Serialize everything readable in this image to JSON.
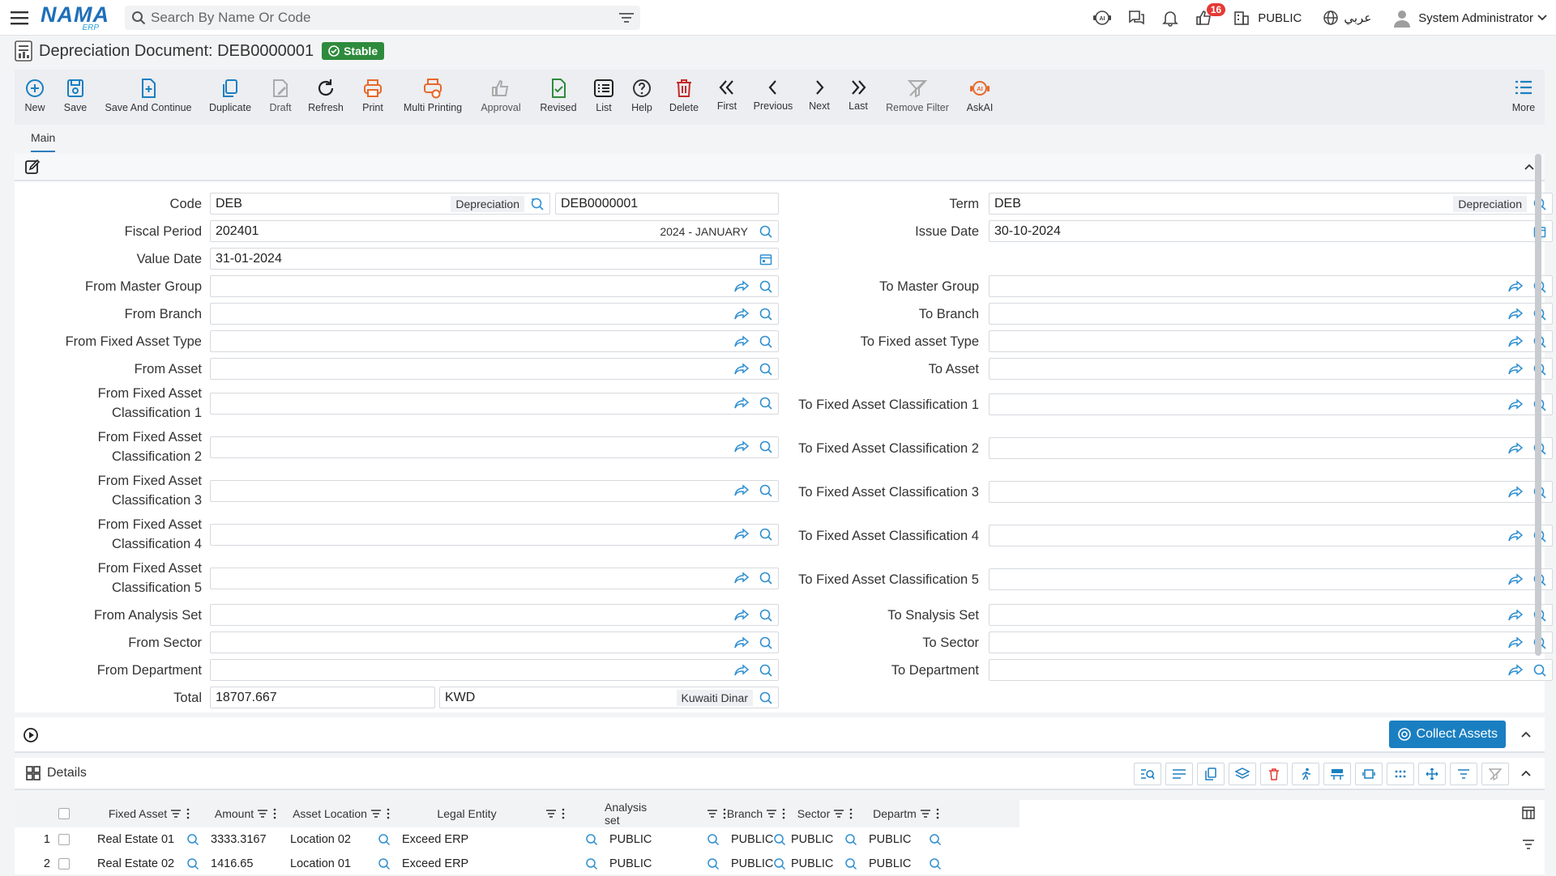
{
  "topbar": {
    "logo_text": "NAMA",
    "logo_sub": "ERP",
    "search_placeholder": "Search By Name Or Code",
    "notification_count": "16",
    "company": "PUBLIC",
    "language": "عربي",
    "user": "System Administrator"
  },
  "page": {
    "title": "Depreciation Document: DEB0000001",
    "status": "Stable"
  },
  "toolbar": {
    "new": "New",
    "save": "Save",
    "save_continue": "Save And Continue",
    "duplicate": "Duplicate",
    "draft": "Draft",
    "refresh": "Refresh",
    "print": "Print",
    "multi_printing": "Multi Printing",
    "approval": "Approval",
    "revised": "Revised",
    "list": "List",
    "help": "Help",
    "delete": "Delete",
    "first": "First",
    "previous": "Previous",
    "next": "Next",
    "last": "Last",
    "remove_filter": "Remove Filter",
    "askai": "AskAI",
    "more": "More"
  },
  "tabs": {
    "main": "Main"
  },
  "form": {
    "code_label": "Code",
    "code_value": "DEB",
    "code_hint": "Depreciation",
    "code_number": "DEB0000001",
    "term_label": "Term",
    "term_value": "DEB",
    "term_hint": "Depreciation",
    "fiscal_label": "Fiscal Period",
    "fiscal_value": "202401",
    "fiscal_hint": "2024 - JANUARY",
    "issue_label": "Issue Date",
    "issue_value": "30-10-2024",
    "value_date_label": "Value Date",
    "value_date_value": "31-01-2024",
    "from_master_group": "From Master Group",
    "to_master_group": "To Master Group",
    "from_branch": "From Branch",
    "to_branch": "To Branch",
    "from_fa_type": "From Fixed Asset Type",
    "to_fa_type": "To Fixed asset Type",
    "from_asset": "From Asset",
    "to_asset": "To Asset",
    "from_cls1_a": "From Fixed Asset",
    "from_cls1_b": "Classification 1",
    "to_cls1": "To Fixed Asset Classification 1",
    "from_cls2_a": "From Fixed Asset",
    "from_cls2_b": "Classification 2",
    "to_cls2": "To Fixed Asset Classification 2",
    "from_cls3_a": "From Fixed Asset",
    "from_cls3_b": "Classification 3",
    "to_cls3": "To Fixed Asset Classification 3",
    "from_cls4_a": "From Fixed Asset",
    "from_cls4_b": "Classification 4",
    "to_cls4": "To Fixed Asset Classification 4",
    "from_cls5_a": "From Fixed Asset",
    "from_cls5_b": "Classification 5",
    "to_cls5": "To Fixed Asset Classification 5",
    "from_analysis": "From Analysis Set",
    "to_analysis": "To Snalysis Set",
    "from_sector": "From Sector",
    "to_sector": "To Sector",
    "from_department": "From Department",
    "to_department": "To Department",
    "total_label": "Total",
    "total_value": "18707.667",
    "currency_value": "KWD",
    "currency_hint": "Kuwaiti Dinar"
  },
  "collect": {
    "label": "Collect Assets"
  },
  "details": {
    "title": "Details",
    "columns": [
      "Fixed Asset",
      "Amount",
      "Asset Location",
      "Legal Entity",
      "Analysis set",
      "Branch",
      "Sector",
      "Departm"
    ],
    "rows": [
      {
        "n": "1",
        "fixed_asset": "Real Estate 01",
        "amount": "3333.3167",
        "location": "Location 02",
        "legal_entity": "Exceed ERP",
        "analysis": "PUBLIC",
        "branch": "PUBLIC",
        "sector": "PUBLIC",
        "department": "PUBLIC"
      },
      {
        "n": "2",
        "fixed_asset": "Real Estate 02",
        "amount": "1416.65",
        "location": "Location 01",
        "legal_entity": "Exceed ERP",
        "analysis": "PUBLIC",
        "branch": "PUBLIC",
        "sector": "PUBLIC",
        "department": "PUBLIC"
      }
    ]
  },
  "colors": {
    "accent": "#1a7fc1",
    "stable": "#2e8b3d",
    "badge": "#e53935",
    "orange": "#e8672a",
    "red": "#c62828",
    "green": "#2e8b3d"
  }
}
